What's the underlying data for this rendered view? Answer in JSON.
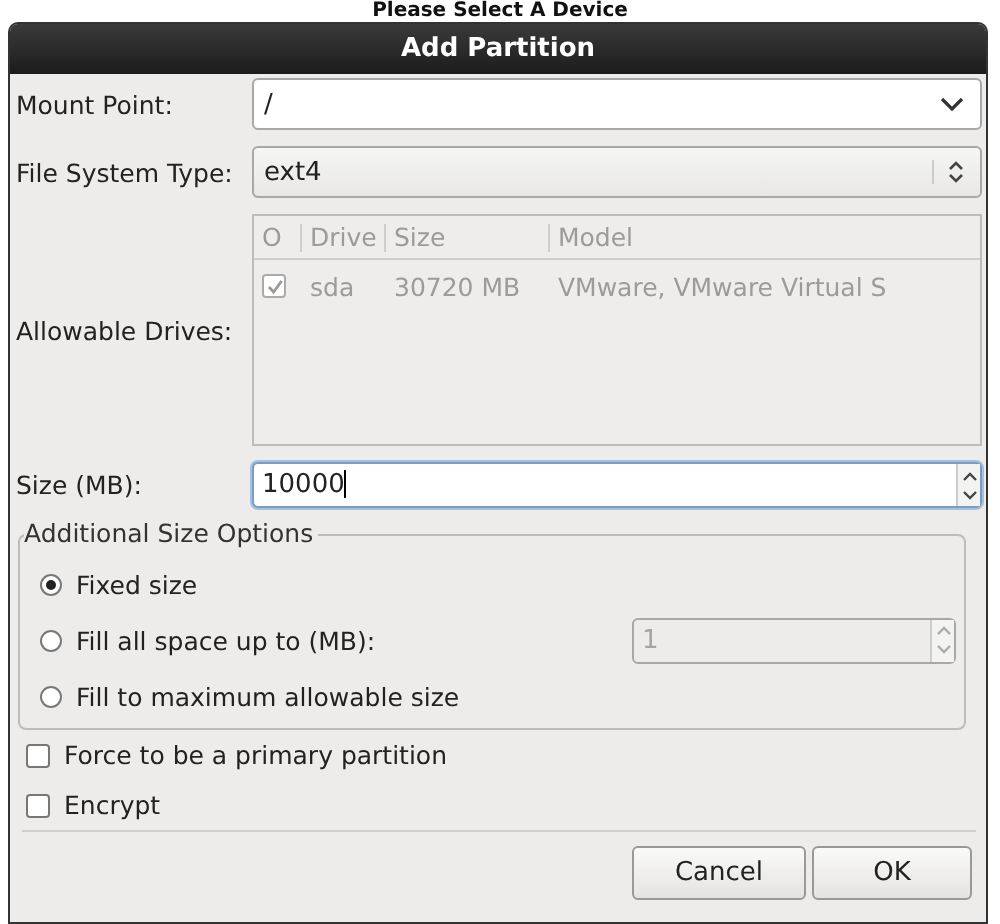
{
  "background": {
    "heading": "Please Select A Device"
  },
  "window": {
    "title": "Add Partition"
  },
  "mount_point": {
    "label": "Mount Point:",
    "value": "/"
  },
  "file_system_type": {
    "label": "File System Type:",
    "value": "ext4"
  },
  "allowable_drives": {
    "label": "Allowable Drives:",
    "disabled": true,
    "columns": [
      "O",
      "Drive",
      "Size",
      "Model"
    ],
    "rows": [
      {
        "checked": true,
        "drive": "sda",
        "size": "30720 MB",
        "model": "VMware, VMware Virtual S"
      }
    ]
  },
  "size": {
    "label": "Size (MB):",
    "value": "10000"
  },
  "size_options": {
    "title": "Additional Size Options",
    "options": [
      {
        "label": "Fixed size",
        "selected": true
      },
      {
        "label": "Fill all space up to (MB):",
        "selected": false,
        "spin_value": "1"
      },
      {
        "label": "Fill to maximum allowable size",
        "selected": false
      }
    ]
  },
  "checkboxes": [
    {
      "label": "Force to be a primary partition",
      "checked": false
    },
    {
      "label": "Encrypt",
      "checked": false
    }
  ],
  "buttons": [
    "Cancel",
    "OK"
  ]
}
